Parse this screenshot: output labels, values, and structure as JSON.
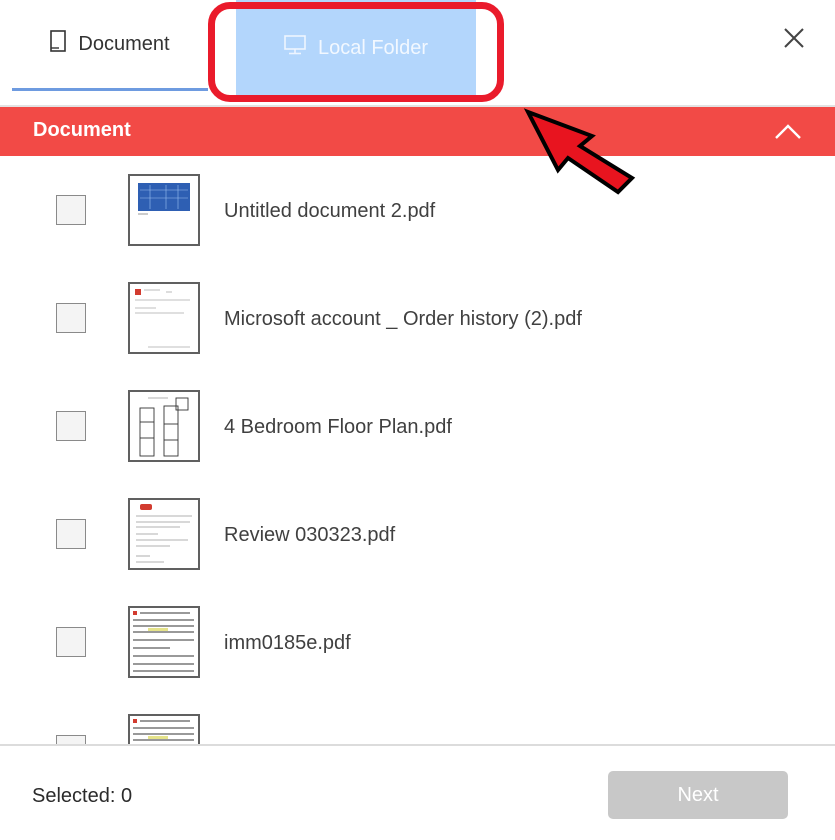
{
  "tabs": {
    "document": {
      "label": "Document",
      "icon": "document-icon"
    },
    "local_folder": {
      "label": "Local Folder",
      "icon": "computer-icon"
    }
  },
  "section": {
    "title": "Document"
  },
  "files": [
    {
      "name": "Untitled document 2.pdf"
    },
    {
      "name": "Microsoft account _ Order history (2).pdf"
    },
    {
      "name": "4 Bedroom Floor Plan.pdf"
    },
    {
      "name": "Review 030323.pdf"
    },
    {
      "name": "imm0185e.pdf"
    },
    {
      "name": ""
    }
  ],
  "footer": {
    "selected_label": "Selected: 0",
    "next_label": "Next"
  },
  "colors": {
    "accent_red": "#f24a46",
    "highlight_red": "#ea1b2b",
    "tab_highlight": "#b3d6fc",
    "tab_underline": "#6e9be0",
    "disabled_button": "#c8c8c8"
  }
}
